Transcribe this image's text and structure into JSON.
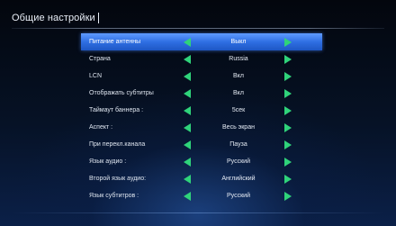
{
  "screen": {
    "title": "Общие настройки"
  },
  "settings": [
    {
      "label": "Питание антенны",
      "value": "Выкл",
      "selected": true
    },
    {
      "label": "Страна",
      "value": "Russia",
      "selected": false
    },
    {
      "label": "LCN",
      "value": "Вкл",
      "selected": false
    },
    {
      "label": "Отображать субтитры",
      "value": "Вкл",
      "selected": false
    },
    {
      "label": "Таймаут баннера :",
      "value": "5сек",
      "selected": false
    },
    {
      "label": "Аспект :",
      "value": "Весь экран",
      "selected": false
    },
    {
      "label": "При перекл.канала",
      "value": "Пауза",
      "selected": false
    },
    {
      "label": "Язык аудио :",
      "value": "Русский",
      "selected": false
    },
    {
      "label": "Второй язык аудио:",
      "value": "Английский",
      "selected": false
    },
    {
      "label": "Язык субтитров :",
      "value": "Русский",
      "selected": false
    }
  ],
  "icons": {
    "left": "arrow-left-icon",
    "right": "arrow-right-icon"
  },
  "colors": {
    "highlight": "#2f6fe3",
    "arrow": "#2fd37a",
    "background": "#061226"
  }
}
